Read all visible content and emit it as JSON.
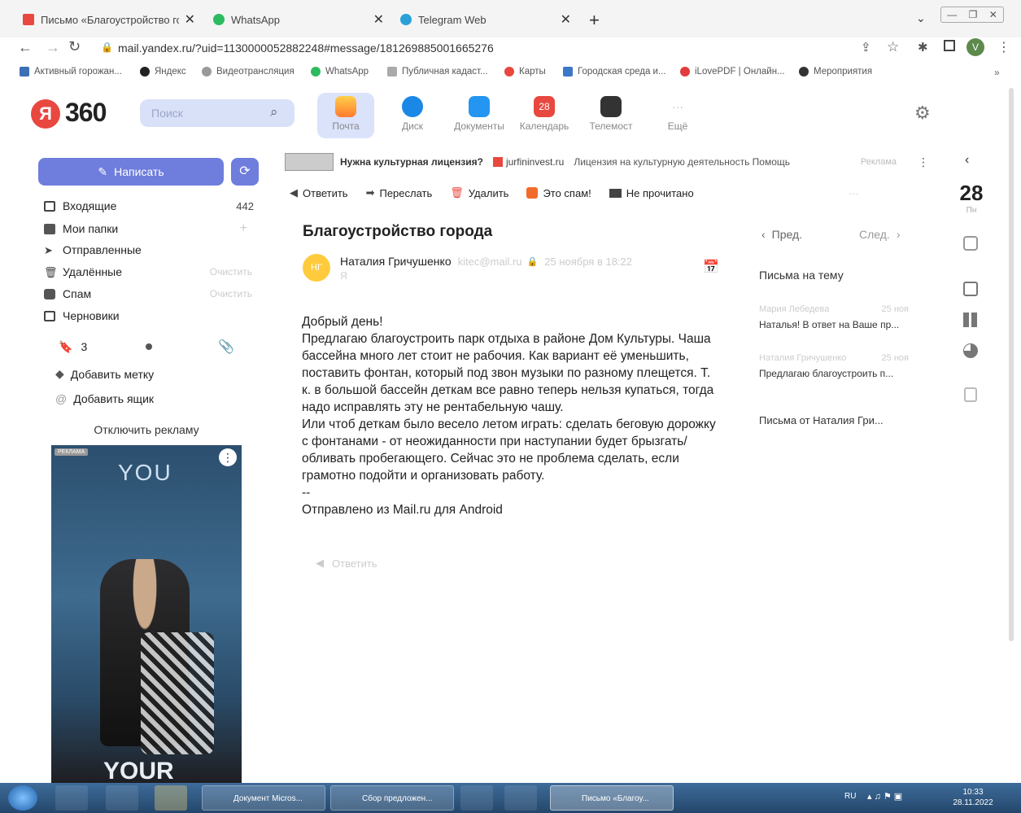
{
  "browser": {
    "tabs": [
      {
        "title": "Письмо «Благоустройство горо"
      },
      {
        "title": "WhatsApp"
      },
      {
        "title": "Telegram Web"
      }
    ],
    "url": "mail.yandex.ru/?uid=1130000052882248#message/181269885001665276",
    "bookmarks": [
      "Активный горожан...",
      "Яндекс",
      "Видеотрансляция",
      "WhatsApp",
      "Публичная кадаст...",
      "Карты",
      "Городская среда и...",
      "iLovePDF | Онлайн...",
      "Мероприятия"
    ]
  },
  "header": {
    "logo_num": "360",
    "search_placeholder": "Поиск",
    "services": [
      {
        "label": "Почта",
        "icon": "mail-icon"
      },
      {
        "label": "Диск",
        "icon": "disk-icon"
      },
      {
        "label": "Документы",
        "icon": "documents-icon"
      },
      {
        "label": "Календарь",
        "icon": "calendar-icon",
        "badge": "28"
      },
      {
        "label": "Телемост",
        "icon": "telemost-icon"
      },
      {
        "label": "Ещё",
        "icon": "more-icon"
      }
    ]
  },
  "sidebar": {
    "compose": "Написать",
    "folders": [
      {
        "name": "Входящие",
        "count": "442"
      },
      {
        "name": "Мои папки",
        "count": "+"
      },
      {
        "name": "Отправленные",
        "count": ""
      },
      {
        "name": "Удалённые",
        "count": "Очистить"
      },
      {
        "name": "Спам",
        "count": "Очистить"
      },
      {
        "name": "Черновики",
        "count": ""
      }
    ],
    "filter_count": "3",
    "add_label": "Добавить метку",
    "add_box": "Добавить ящик",
    "disable_ads": "Отключить рекламу",
    "ad_tag": "РЕКЛАМА",
    "ad_title": "YOU",
    "ad_bottom": "YOUR"
  },
  "adline": {
    "text": "Нужна культурная лицензия?",
    "domain": "jurfininvest.ru",
    "desc": "Лицензия на культурную деятельность  Помощь",
    "tag": "Реклама"
  },
  "toolbar": {
    "reply": "Ответить",
    "forward": "Переслать",
    "delete": "Удалить",
    "spam": "Это спам!",
    "unread": "Не прочитано"
  },
  "message": {
    "subject": "Благоустройство города",
    "sender": "Наталия Гричушенко",
    "sender_email": "kitec@mail.ru",
    "date": "25 ноября в 18:22",
    "to": "Я",
    "avatar": "НГ",
    "body": [
      "Добрый день!",
      "Предлагаю благоустроить парк отдыха в районе Дом Культуры. Чаша",
      "бассейна много лет стоит не рабочия. Как вариант её уменьшить,",
      "поставить фонтан, который под звон музыки по разному плещется.  Т.",
      "к. в большой бассейн деткам все равно теперь нельзя купаться, тогда",
      "надо исправлять эту не рентабельную чашу.",
      "Или чтоб деткам было весело летом играть: сделать беговую дорожку",
      "с фонтанами - от неожиданности при наступании будет брызгать/",
      "обливать пробегающего. Сейчас это не проблема сделать, если",
      "грамотно подойти и организовать работу.",
      "--",
      "Отправлено из Mail.ru для Android"
    ],
    "reply_link": "Ответить"
  },
  "thread": {
    "prev": "Пред.",
    "next": "След.",
    "heading": "Письма на тему",
    "items": [
      {
        "from": "Мария Лебедева",
        "date": "25 ноя",
        "snippet": "Наталья! В ответ на Ваше пр..."
      },
      {
        "from": "Наталия Гричушенко",
        "date": "25 ноя",
        "snippet": "Предлагаю благоустроить п..."
      }
    ],
    "from_heading": "Письма от Наталия Гри..."
  },
  "calendar": {
    "day": "28",
    "weekday": "Пн"
  },
  "taskbar": {
    "items": [
      "Документ Micros...",
      "Сбор предложен...",
      "Письмо «Благоу..."
    ],
    "lang": "RU",
    "time": "10:33",
    "date": "28.11.2022"
  },
  "colors": {
    "accent": "#6f7ddc",
    "red": "#e8483f",
    "blue": "#1b87e6"
  }
}
